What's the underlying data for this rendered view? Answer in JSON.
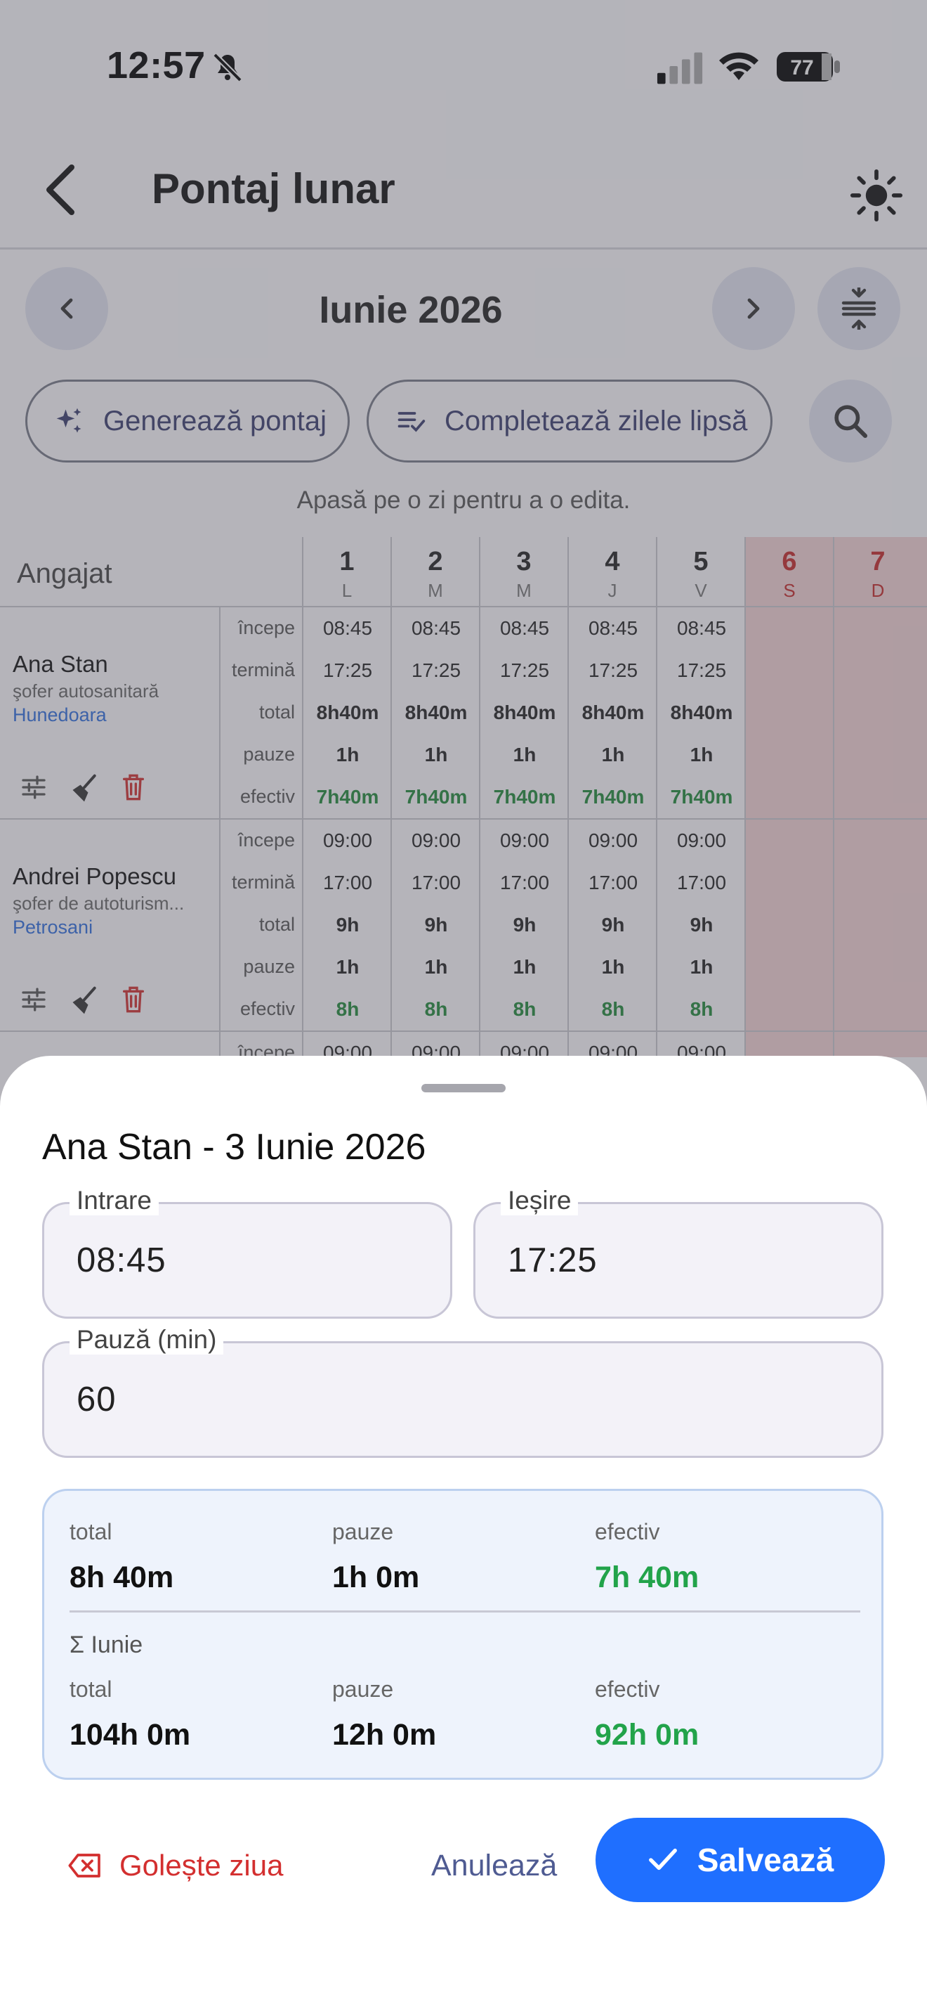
{
  "status_bar": {
    "time": "12:57",
    "battery": "77"
  },
  "header": {
    "title": "Pontaj lunar"
  },
  "month_nav": {
    "label": "Iunie 2026"
  },
  "actions": {
    "generate_label": "Generează pontaj",
    "fill_missing_label": "Completează zilele lipsă"
  },
  "hint": "Apasă pe o zi pentru a o edita.",
  "grid": {
    "employee_header": "Angajat",
    "row_labels": [
      "începe",
      "termină",
      "total",
      "pauze",
      "efectiv"
    ],
    "days": [
      {
        "num": "1",
        "name": "L"
      },
      {
        "num": "2",
        "name": "M"
      },
      {
        "num": "3",
        "name": "M"
      },
      {
        "num": "4",
        "name": "J"
      },
      {
        "num": "5",
        "name": "V"
      },
      {
        "num": "6",
        "name": "S"
      },
      {
        "num": "7",
        "name": "D"
      }
    ],
    "employees": [
      {
        "name": "Ana Stan",
        "role": "şofer autosanitară",
        "city": "Hunedoara",
        "start": "08:45",
        "end": "17:25",
        "total": "8h40m",
        "pauses": "1h",
        "effective": "7h40m"
      },
      {
        "name": "Andrei Popescu",
        "role": "şofer de autoturism...",
        "city": "Petrosani",
        "start": "09:00",
        "end": "17:00",
        "total": "9h",
        "pauses": "1h",
        "effective": "8h"
      }
    ],
    "partial_row": {
      "start": "09:00"
    }
  },
  "sheet": {
    "title": "Ana Stan - 3 Iunie 2026",
    "entry_label": "Intrare",
    "entry_value": "08:45",
    "exit_label": "Ieșire",
    "exit_value": "17:25",
    "pause_label": "Pauză (min)",
    "pause_value": "60",
    "day": {
      "total_label": "total",
      "total": "8h 40m",
      "pauses_label": "pauze",
      "pauses": "1h 0m",
      "effective_label": "efectiv",
      "effective": "7h 40m"
    },
    "month_label": "Σ Iunie",
    "month": {
      "total_label": "total",
      "total": "104h 0m",
      "pauses_label": "pauze",
      "pauses": "12h 0m",
      "effective_label": "efectiv",
      "effective": "92h 0m"
    },
    "clear_label": "Golește ziua",
    "cancel_label": "Anulează",
    "save_label": "Salvează"
  },
  "colors": {
    "accent": "#1f6fff",
    "positive": "#22a34a",
    "danger": "#d32f2f",
    "weekend": "#c62828"
  }
}
